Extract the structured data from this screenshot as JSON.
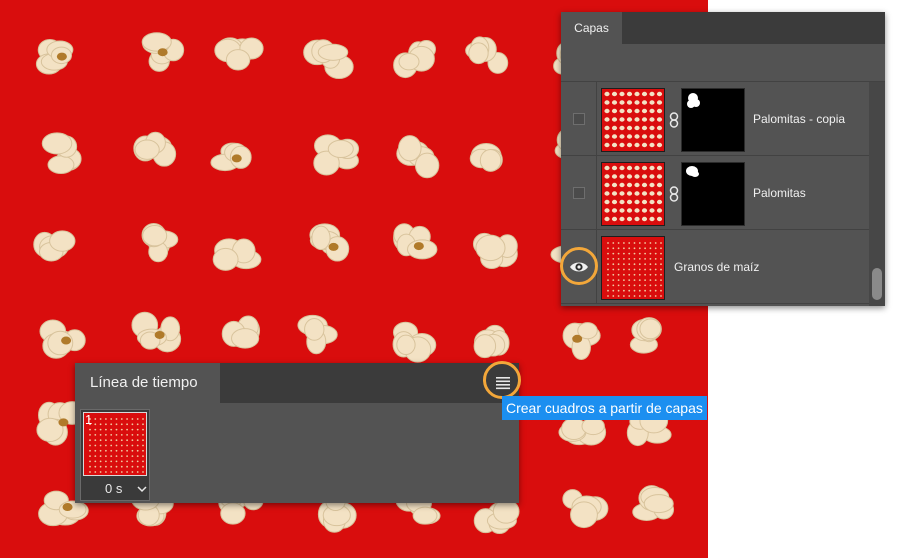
{
  "colors": {
    "canvas_red": "#d90d0d",
    "panel_bg": "#535353",
    "panel_dark": "#3b3b3b",
    "highlight_ring": "#f3a73a",
    "tooltip_bg": "#1c8ff0",
    "popcorn": "#f3e2c4"
  },
  "layers_panel": {
    "tab_label": "Capas",
    "layers": [
      {
        "name": "Palomitas - copia",
        "visible": false,
        "has_mask": true,
        "thumb": "popcorn-grid",
        "mask_icon": "white-shape"
      },
      {
        "name": "Palomitas",
        "visible": false,
        "has_mask": true,
        "thumb": "popcorn-grid",
        "mask_icon": "white-shape"
      },
      {
        "name": "Granos de maíz",
        "visible": true,
        "has_mask": false,
        "thumb": "kernel-dots",
        "eye_icon": "eye-icon"
      }
    ]
  },
  "timeline_panel": {
    "tab_label": "Línea de tiempo",
    "menu_icon": "panel-menu-icon",
    "frame": {
      "number": "1",
      "delay": "0 s"
    }
  },
  "tooltip": {
    "text": "Crear cuadros a partir de capas"
  }
}
